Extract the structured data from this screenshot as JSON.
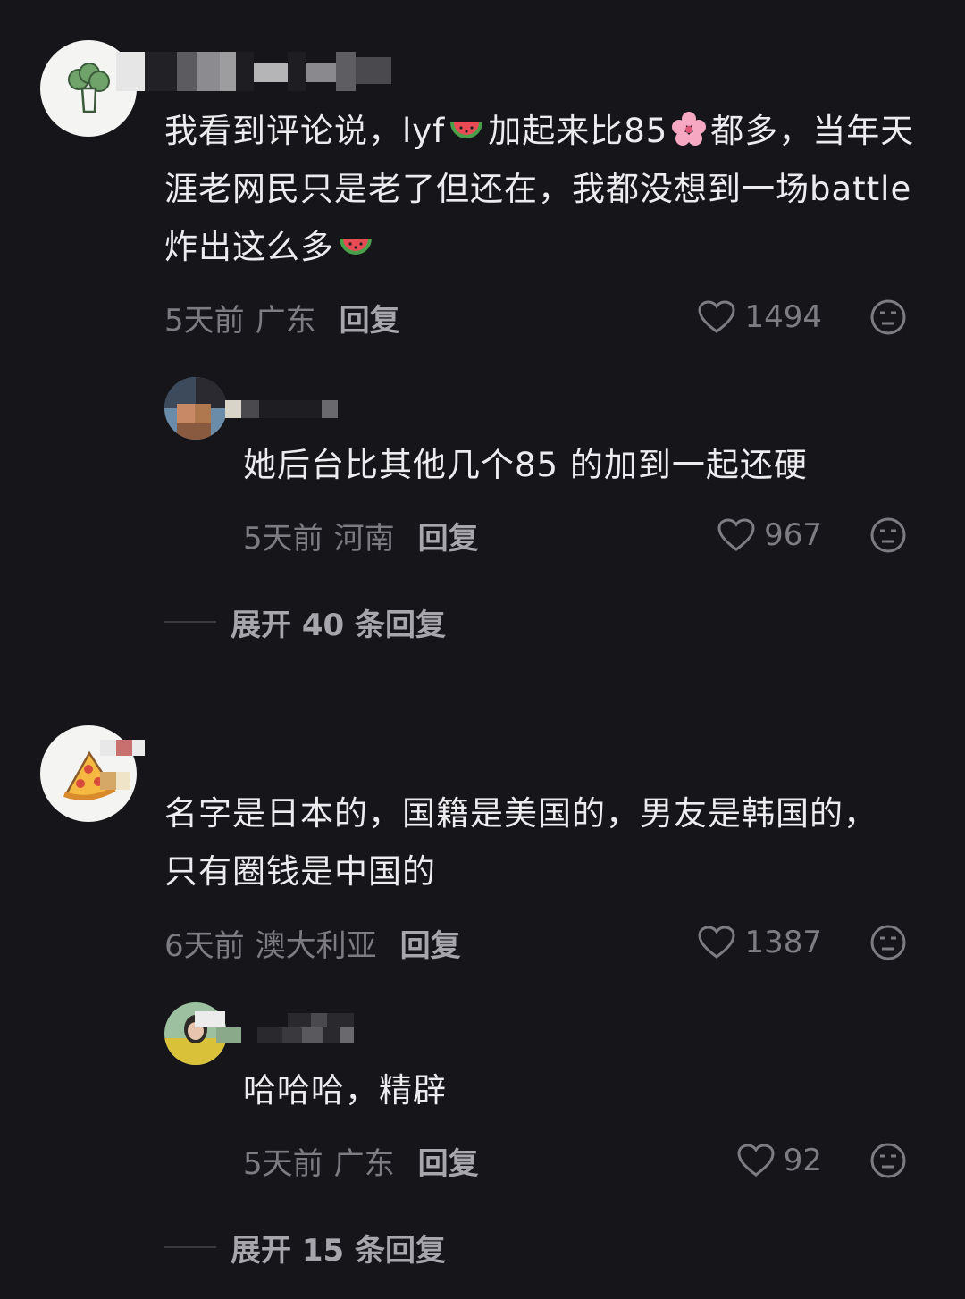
{
  "threads": [
    {
      "comment": {
        "avatar_icon": "broccoli-icon",
        "text_parts": [
          "我看到评论说，lyf",
          "加起来比85",
          "都多，当年天涯老网民只是老了但还在，我都没想到一场battle炸出这么多"
        ],
        "time": "5天前",
        "location": "广东",
        "reply_label": "回复",
        "likes": "1494"
      },
      "reply": {
        "text": "她后台比其他几个85 的加到一起还硬",
        "time": "5天前",
        "location": "河南",
        "reply_label": "回复",
        "likes": "967"
      },
      "expand_label": "展开 40 条回复"
    },
    {
      "comment": {
        "avatar_icon": "pizza-icon",
        "text": "名字是日本的，国籍是美国的，男友是韩国的，只有圈钱是中国的",
        "time": "6天前",
        "location": "澳大利亚",
        "reply_label": "回复",
        "likes": "1387"
      },
      "reply": {
        "text": "哈哈哈，精辟",
        "time": "5天前",
        "location": "广东",
        "reply_label": "回复",
        "likes": "92"
      },
      "expand_label": "展开 15 条回复"
    }
  ],
  "colors": {
    "background": "#16161a",
    "text": "#ececee",
    "meta": "#7c7c82",
    "action": "#a6a6ac"
  }
}
